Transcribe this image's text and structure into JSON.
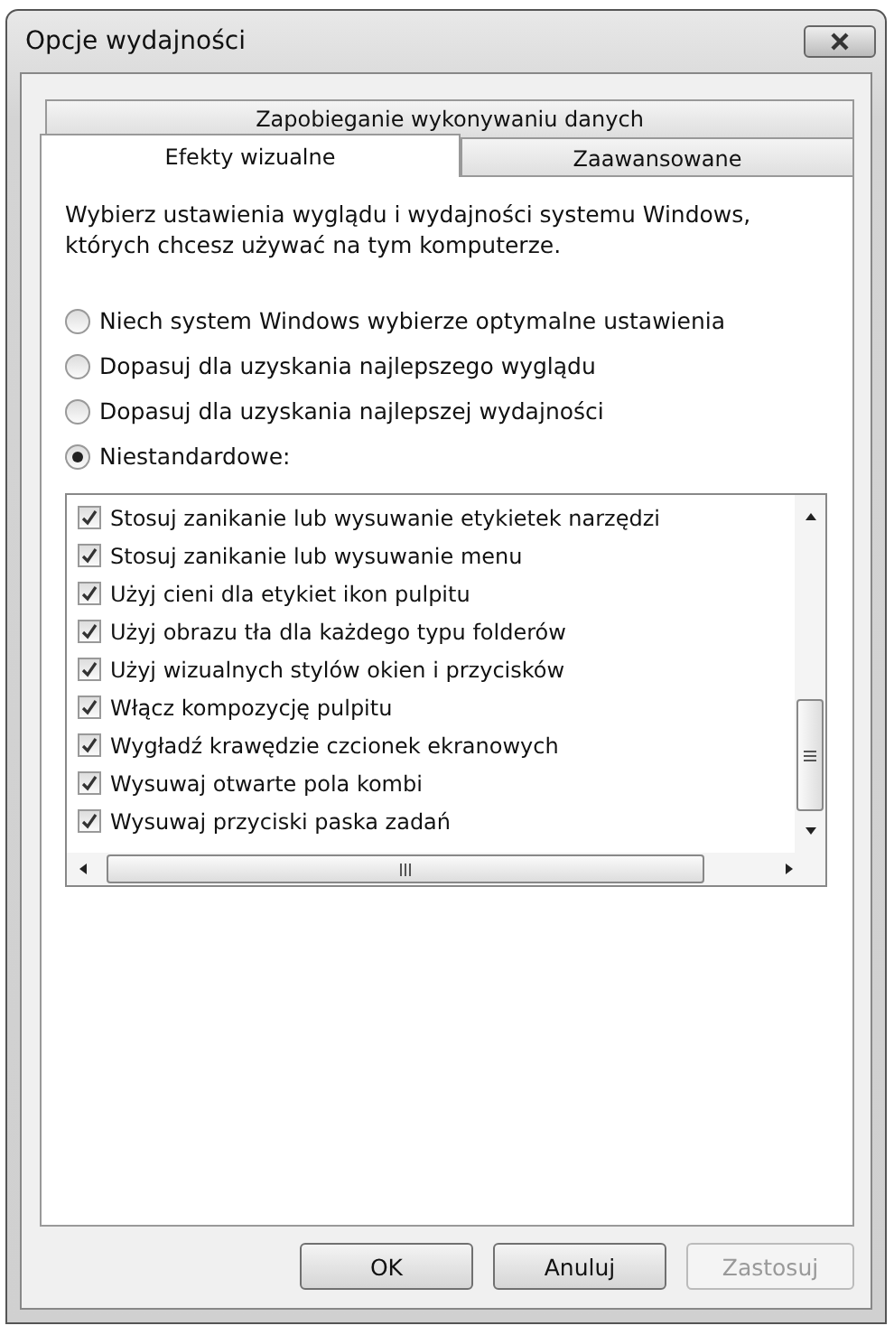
{
  "window": {
    "title": "Opcje wydajności"
  },
  "tabs": [
    {
      "label": "Zapobieganie wykonywaniu danych",
      "selected": false
    },
    {
      "label": "Efekty wizualne",
      "selected": true
    },
    {
      "label": "Zaawansowane",
      "selected": false
    }
  ],
  "description": "Wybierz ustawienia wyglądu i wydajności systemu Windows, których chcesz używać na tym komputerze.",
  "options": [
    {
      "label": "Niech system Windows wybierze optymalne ustawienia",
      "selected": false
    },
    {
      "label": "Dopasuj dla uzyskania najlepszego wyglądu",
      "selected": false
    },
    {
      "label": "Dopasuj dla uzyskania najlepszej wydajności",
      "selected": false
    },
    {
      "label": "Niestandardowe:",
      "selected": true
    }
  ],
  "effects": [
    {
      "label": "Stosuj zanikanie lub wysuwanie etykietek narzędzi",
      "checked": true
    },
    {
      "label": "Stosuj zanikanie lub wysuwanie menu",
      "checked": true
    },
    {
      "label": "Użyj cieni dla etykiet ikon pulpitu",
      "checked": true
    },
    {
      "label": "Użyj obrazu tła dla każdego typu folderów",
      "checked": true
    },
    {
      "label": "Użyj wizualnych stylów okien i przycisków",
      "checked": true
    },
    {
      "label": "Włącz kompozycję pulpitu",
      "checked": true
    },
    {
      "label": "Wygładź krawędzie czcionek ekranowych",
      "checked": true
    },
    {
      "label": "Wysuwaj otwarte pola kombi",
      "checked": true
    },
    {
      "label": "Wysuwaj przyciski paska zadań",
      "checked": true
    }
  ],
  "buttons": [
    {
      "label": "OK",
      "disabled": false
    },
    {
      "label": "Anuluj",
      "disabled": false
    },
    {
      "label": "Zastosuj",
      "disabled": true
    }
  ]
}
